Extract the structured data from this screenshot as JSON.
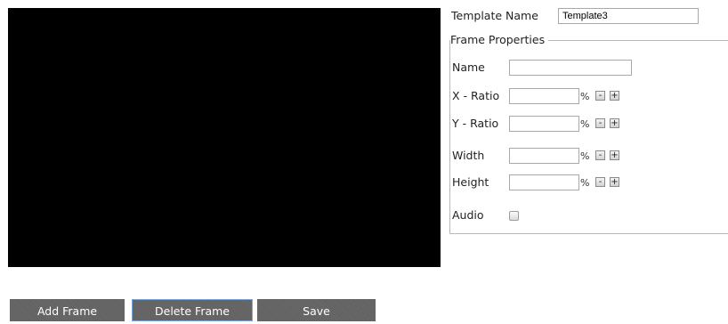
{
  "template": {
    "label": "Template Name",
    "value": "Template3"
  },
  "frame_properties": {
    "legend": "Frame Properties",
    "name": {
      "label": "Name",
      "value": ""
    },
    "x_ratio": {
      "label": "X - Ratio",
      "value": "",
      "unit": "%",
      "minus": "-",
      "plus": "+"
    },
    "y_ratio": {
      "label": "Y - Ratio",
      "value": "",
      "unit": "%",
      "minus": "-",
      "plus": "+"
    },
    "width": {
      "label": "Width",
      "value": "",
      "unit": "%",
      "minus": "-",
      "plus": "+"
    },
    "height": {
      "label": "Height",
      "value": "",
      "unit": "%",
      "minus": "-",
      "plus": "+"
    },
    "audio": {
      "label": "Audio",
      "checked": false
    }
  },
  "actions": {
    "add_frame": "Add Frame",
    "delete_frame": "Delete Frame",
    "save": "Save"
  },
  "colors": {
    "preview_background": "#000000",
    "button_background": "#666666",
    "button_text": "#ffffff",
    "active_button_border": "#7aa7d8"
  }
}
